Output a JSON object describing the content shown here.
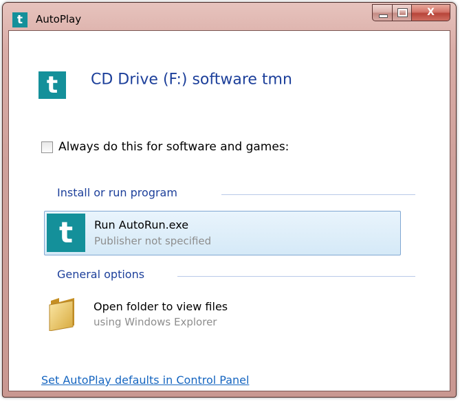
{
  "window": {
    "title": "AutoPlay",
    "icon_glyph": "t",
    "close_glyph": "X"
  },
  "header": {
    "title": "CD Drive (F:) software tmn",
    "icon_glyph": "t"
  },
  "always": {
    "label": "Always do this for software and games:",
    "checked": false
  },
  "sections": {
    "install": {
      "title": "Install or run program"
    },
    "general": {
      "title": "General options"
    }
  },
  "options": {
    "run_autorun": {
      "main": "Run AutoRun.exe",
      "sub": "Publisher not specified",
      "icon_glyph": "t"
    },
    "open_folder": {
      "main": "Open folder to view files",
      "sub": "using Windows Explorer"
    }
  },
  "footer": {
    "link": "Set AutoPlay defaults in Control Panel"
  },
  "colors": {
    "accent": "#14909a",
    "heading": "#1c3f9a",
    "link": "#1565c0"
  }
}
